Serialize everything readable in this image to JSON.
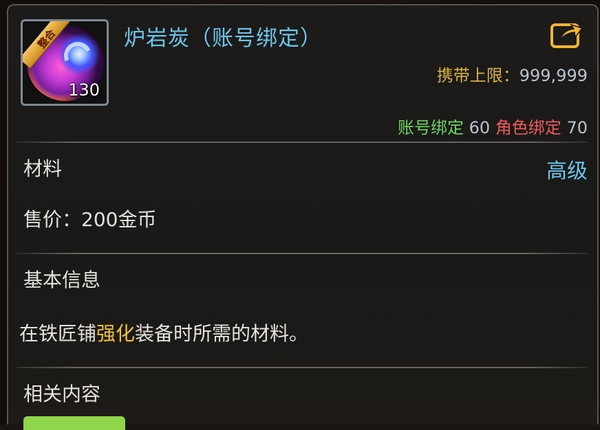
{
  "item": {
    "name": "炉岩炭（账号绑定）",
    "badge": "整合",
    "count": "130"
  },
  "carry_limit": {
    "label": "携带上限：",
    "value": "999,999"
  },
  "bind_info": {
    "account_label": "账号绑定",
    "account_value": "60",
    "role_label": "角色绑定",
    "role_value": "70"
  },
  "category": "材料",
  "grade": "高级",
  "price": "售价：200金币",
  "basic_info": {
    "heading": "基本信息",
    "desc_prefix": "在铁匠铺",
    "desc_highlight": "强化",
    "desc_suffix": "装备时所需的材料。"
  },
  "related": {
    "heading": "相关内容"
  },
  "colors": {
    "title": "#6cc6ea",
    "gold": "#d8b03e",
    "account_bind": "#6bd45f",
    "role_bind": "#ef5a5a",
    "highlight": "#f4c23c"
  },
  "icons": {
    "share": "share-export-icon"
  }
}
